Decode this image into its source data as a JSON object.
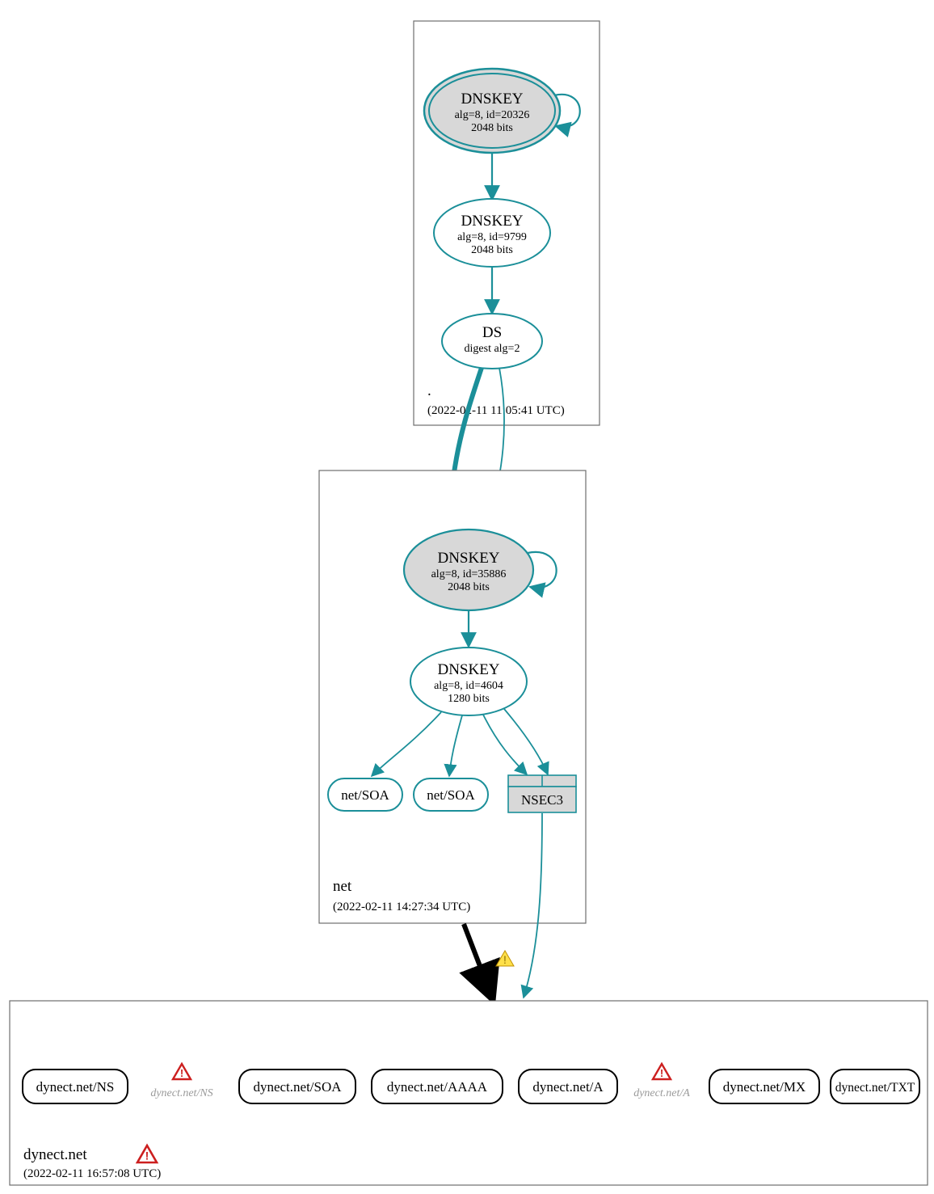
{
  "zones": {
    "root": {
      "label": ".",
      "timestamp": "(2022-02-11 11:05:41 UTC)",
      "nodes": {
        "ksk": {
          "title": "DNSKEY",
          "line1": "alg=8, id=20326",
          "line2": "2048 bits"
        },
        "zsk": {
          "title": "DNSKEY",
          "line1": "alg=8, id=9799",
          "line2": "2048 bits"
        },
        "ds": {
          "title": "DS",
          "line1": "digest alg=2"
        }
      }
    },
    "net": {
      "label": "net",
      "timestamp": "(2022-02-11 14:27:34 UTC)",
      "nodes": {
        "ksk": {
          "title": "DNSKEY",
          "line1": "alg=8, id=35886",
          "line2": "2048 bits"
        },
        "zsk": {
          "title": "DNSKEY",
          "line1": "alg=8, id=4604",
          "line2": "1280 bits"
        },
        "soa1": {
          "title": "net/SOA"
        },
        "soa2": {
          "title": "net/SOA"
        },
        "nsec3": {
          "title": "NSEC3"
        }
      }
    },
    "dynect": {
      "label": "dynect.net",
      "timestamp": "(2022-02-11 16:57:08 UTC)",
      "records": {
        "ns": "dynect.net/NS",
        "ns_b": "dynect.net/NS",
        "soa": "dynect.net/SOA",
        "aaaa": "dynect.net/AAAA",
        "a": "dynect.net/A",
        "a_b": "dynect.net/A",
        "mx": "dynect.net/MX",
        "txt": "dynect.net/TXT"
      }
    }
  }
}
